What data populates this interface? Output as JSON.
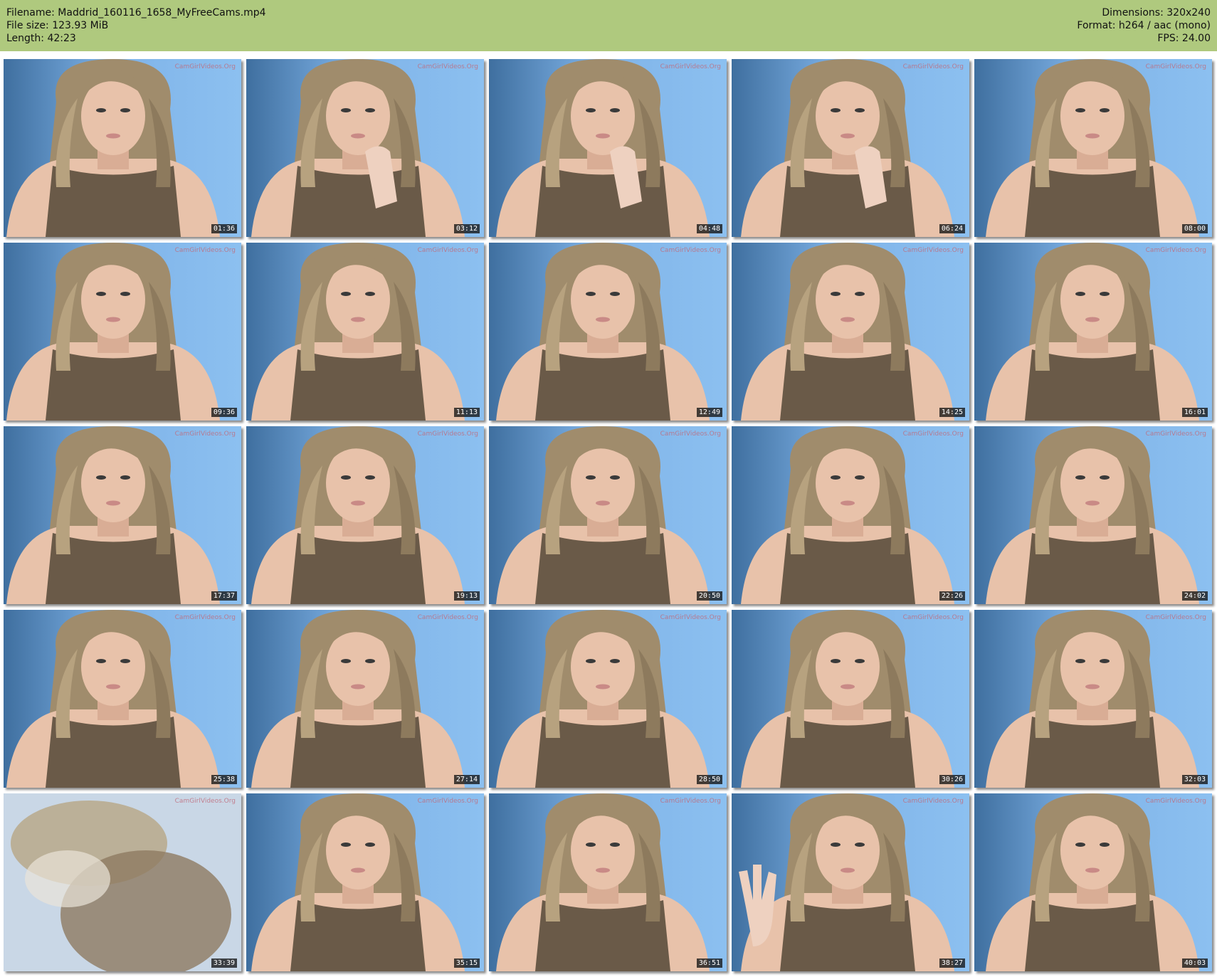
{
  "header": {
    "filename": "Filename: Maddrid_160116_1658_MyFreeCams.mp4",
    "filesize": "File size: 123.93 MiB",
    "length": "Length: 42:23",
    "dimensions": "Dimensions: 320x240",
    "format": "Format: h264 / aac (mono)",
    "fps": "FPS: 24.00"
  },
  "watermark": "CamGirlVideos.Org",
  "colors": {
    "header_bg": "#afc97e",
    "wall_light": "#7fb3e8",
    "wall_dark": "#3f6f9f",
    "hair": "#a08c6c",
    "skin": "#e8c2aa",
    "top": "#6a5a48"
  },
  "thumbnails": [
    {
      "time": "01:36",
      "variant": "face"
    },
    {
      "time": "03:12",
      "variant": "hand"
    },
    {
      "time": "04:48",
      "variant": "hand"
    },
    {
      "time": "06:24",
      "variant": "hand"
    },
    {
      "time": "08:00",
      "variant": "face"
    },
    {
      "time": "09:36",
      "variant": "face"
    },
    {
      "time": "11:13",
      "variant": "face"
    },
    {
      "time": "12:49",
      "variant": "face"
    },
    {
      "time": "14:25",
      "variant": "face"
    },
    {
      "time": "16:01",
      "variant": "face"
    },
    {
      "time": "17:37",
      "variant": "face"
    },
    {
      "time": "19:13",
      "variant": "face"
    },
    {
      "time": "20:50",
      "variant": "face"
    },
    {
      "time": "22:26",
      "variant": "face"
    },
    {
      "time": "24:02",
      "variant": "face"
    },
    {
      "time": "25:38",
      "variant": "face"
    },
    {
      "time": "27:14",
      "variant": "face"
    },
    {
      "time": "28:50",
      "variant": "face"
    },
    {
      "time": "30:26",
      "variant": "face"
    },
    {
      "time": "32:03",
      "variant": "face"
    },
    {
      "time": "33:39",
      "variant": "blur"
    },
    {
      "time": "35:15",
      "variant": "face"
    },
    {
      "time": "36:51",
      "variant": "face"
    },
    {
      "time": "38:27",
      "variant": "wave"
    },
    {
      "time": "40:03",
      "variant": "face"
    }
  ]
}
